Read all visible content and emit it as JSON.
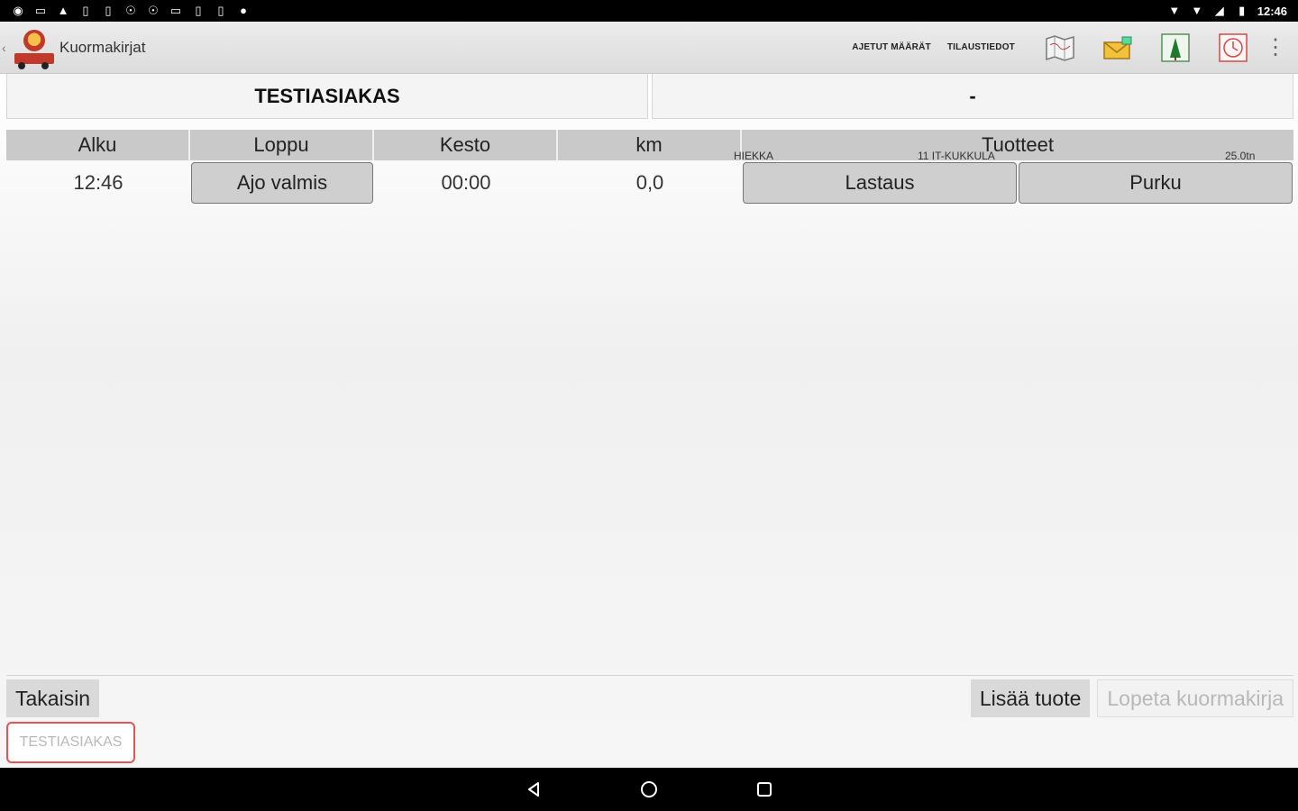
{
  "status_bar": {
    "left_icons": [
      "notification-icon",
      "notification-icon",
      "notification-icon",
      "notification-icon",
      "notification-icon",
      "notification-icon",
      "notification-icon",
      "notification-icon",
      "notification-icon",
      "notification-icon",
      "notification-icon"
    ],
    "time": "12:46"
  },
  "action_bar": {
    "title": "Kuormakirjat",
    "ajetut_maarat": "AJETUT MÄÄRÄT",
    "tilaustiedot": "TILAUSTIEDOT"
  },
  "customer": {
    "name": "TESTIASIAKAS",
    "secondary": "-"
  },
  "table": {
    "headers": [
      "Alku",
      "Loppu",
      "Kesto",
      "km",
      "Tuotteet"
    ],
    "row": {
      "alku": "12:46",
      "loppu_button": "Ajo valmis",
      "kesto": "00:00",
      "km": "0,0",
      "lastaus_button": "Lastaus",
      "purku_button": "Purku"
    },
    "product": {
      "name": "HIEKKA",
      "location": "11 IT-KUKKULA",
      "amount": "25.0tn"
    }
  },
  "footer": {
    "back_button": "Takaisin",
    "add_product_button": "Lisää tuote",
    "end_button": "Lopeta kuormakirja",
    "customer_tag": "TESTIASIAKAS"
  },
  "colors": {
    "accent_red": "#e05555",
    "header_gray": "#c9c9c9"
  }
}
